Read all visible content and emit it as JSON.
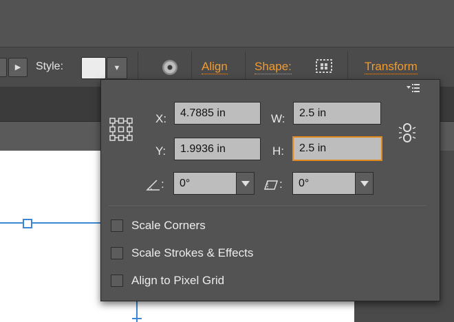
{
  "control_bar": {
    "style_label": "Style:",
    "align_link": "Align",
    "shape_link": "Shape:",
    "transform_link": "Transform"
  },
  "transform_panel": {
    "x": {
      "label": "X:",
      "value": "4.7885 in"
    },
    "y": {
      "label": "Y:",
      "value": "1.9936 in"
    },
    "w": {
      "label": "W:",
      "value": "2.5 in"
    },
    "h": {
      "label": "H:",
      "value": "2.5 in"
    },
    "rotate": {
      "separator": ":",
      "value": "0°"
    },
    "shear": {
      "separator": ":",
      "value": "0°"
    },
    "options": [
      {
        "label": "Scale Corners",
        "checked": false
      },
      {
        "label": "Scale Strokes & Effects",
        "checked": false
      },
      {
        "label": "Align to Pixel Grid",
        "checked": false
      }
    ]
  },
  "icons": {
    "reference_point": "reference-point-icon",
    "constrain": "constrain-proportions-icon",
    "rotate": "rotate-angle-icon",
    "shear": "shear-angle-icon",
    "panel_menu": "panel-menu-icon",
    "recolor": "recolor-artwork-icon",
    "shape": "shape-icon"
  },
  "colors": {
    "accent_link": "#f29b2e",
    "focus_ring": "#e08a1e",
    "selection": "#3b86d4",
    "panel_bg": "#535353"
  }
}
